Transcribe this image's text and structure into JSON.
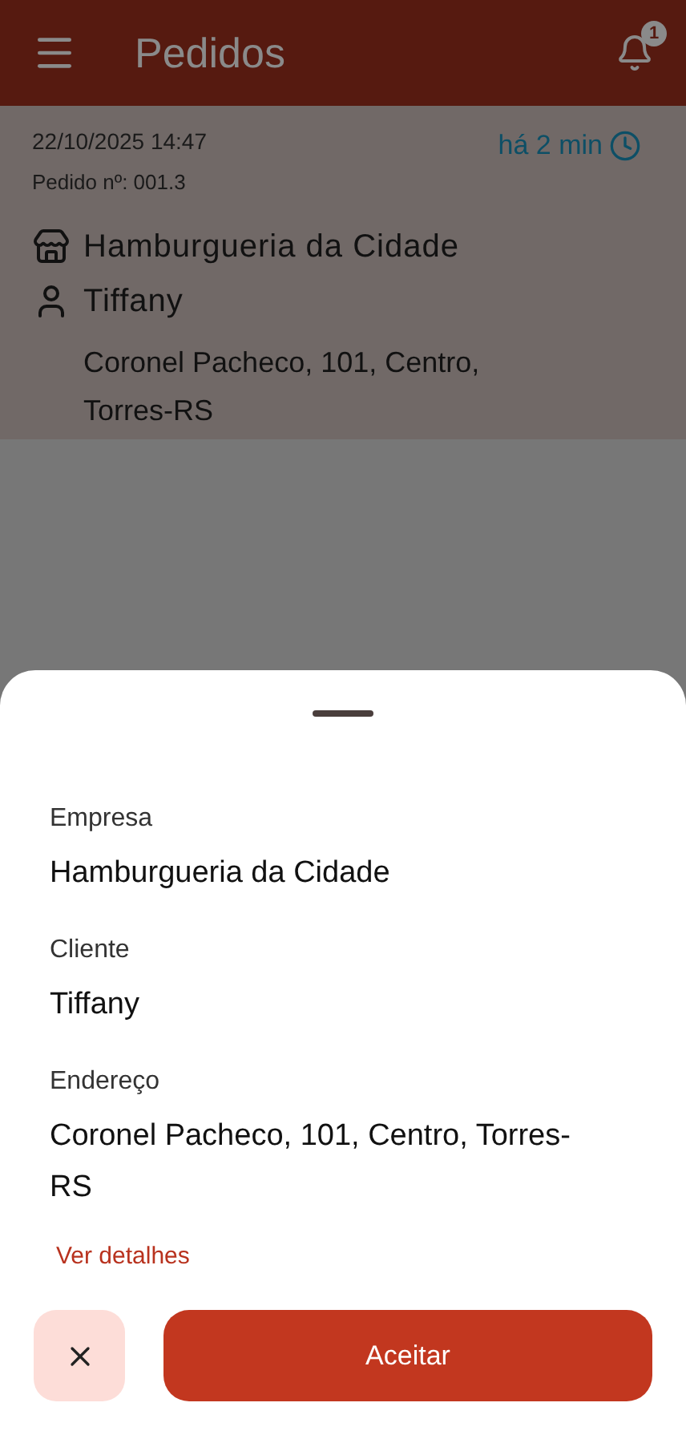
{
  "app_bar": {
    "title": "Pedidos",
    "notification_count": "1"
  },
  "order": {
    "datetime": "22/10/2025 14:47",
    "number": "Pedido nº: 001.3",
    "elapsed": "há 2 min",
    "company": "Hamburgueria da Cidade",
    "client": "Tiffany",
    "address": "Coronel Pacheco, 101, Centro, Torres-RS"
  },
  "sheet": {
    "fields": [
      {
        "label": "Empresa",
        "value": "Hamburgueria da Cidade"
      },
      {
        "label": "Cliente",
        "value": "Tiffany"
      },
      {
        "label": "Endereço",
        "value": "Coronel Pacheco, 101, Centro, Torres-RS"
      }
    ],
    "link": "Ver detalhes",
    "accept_button": "Aceitar"
  }
}
